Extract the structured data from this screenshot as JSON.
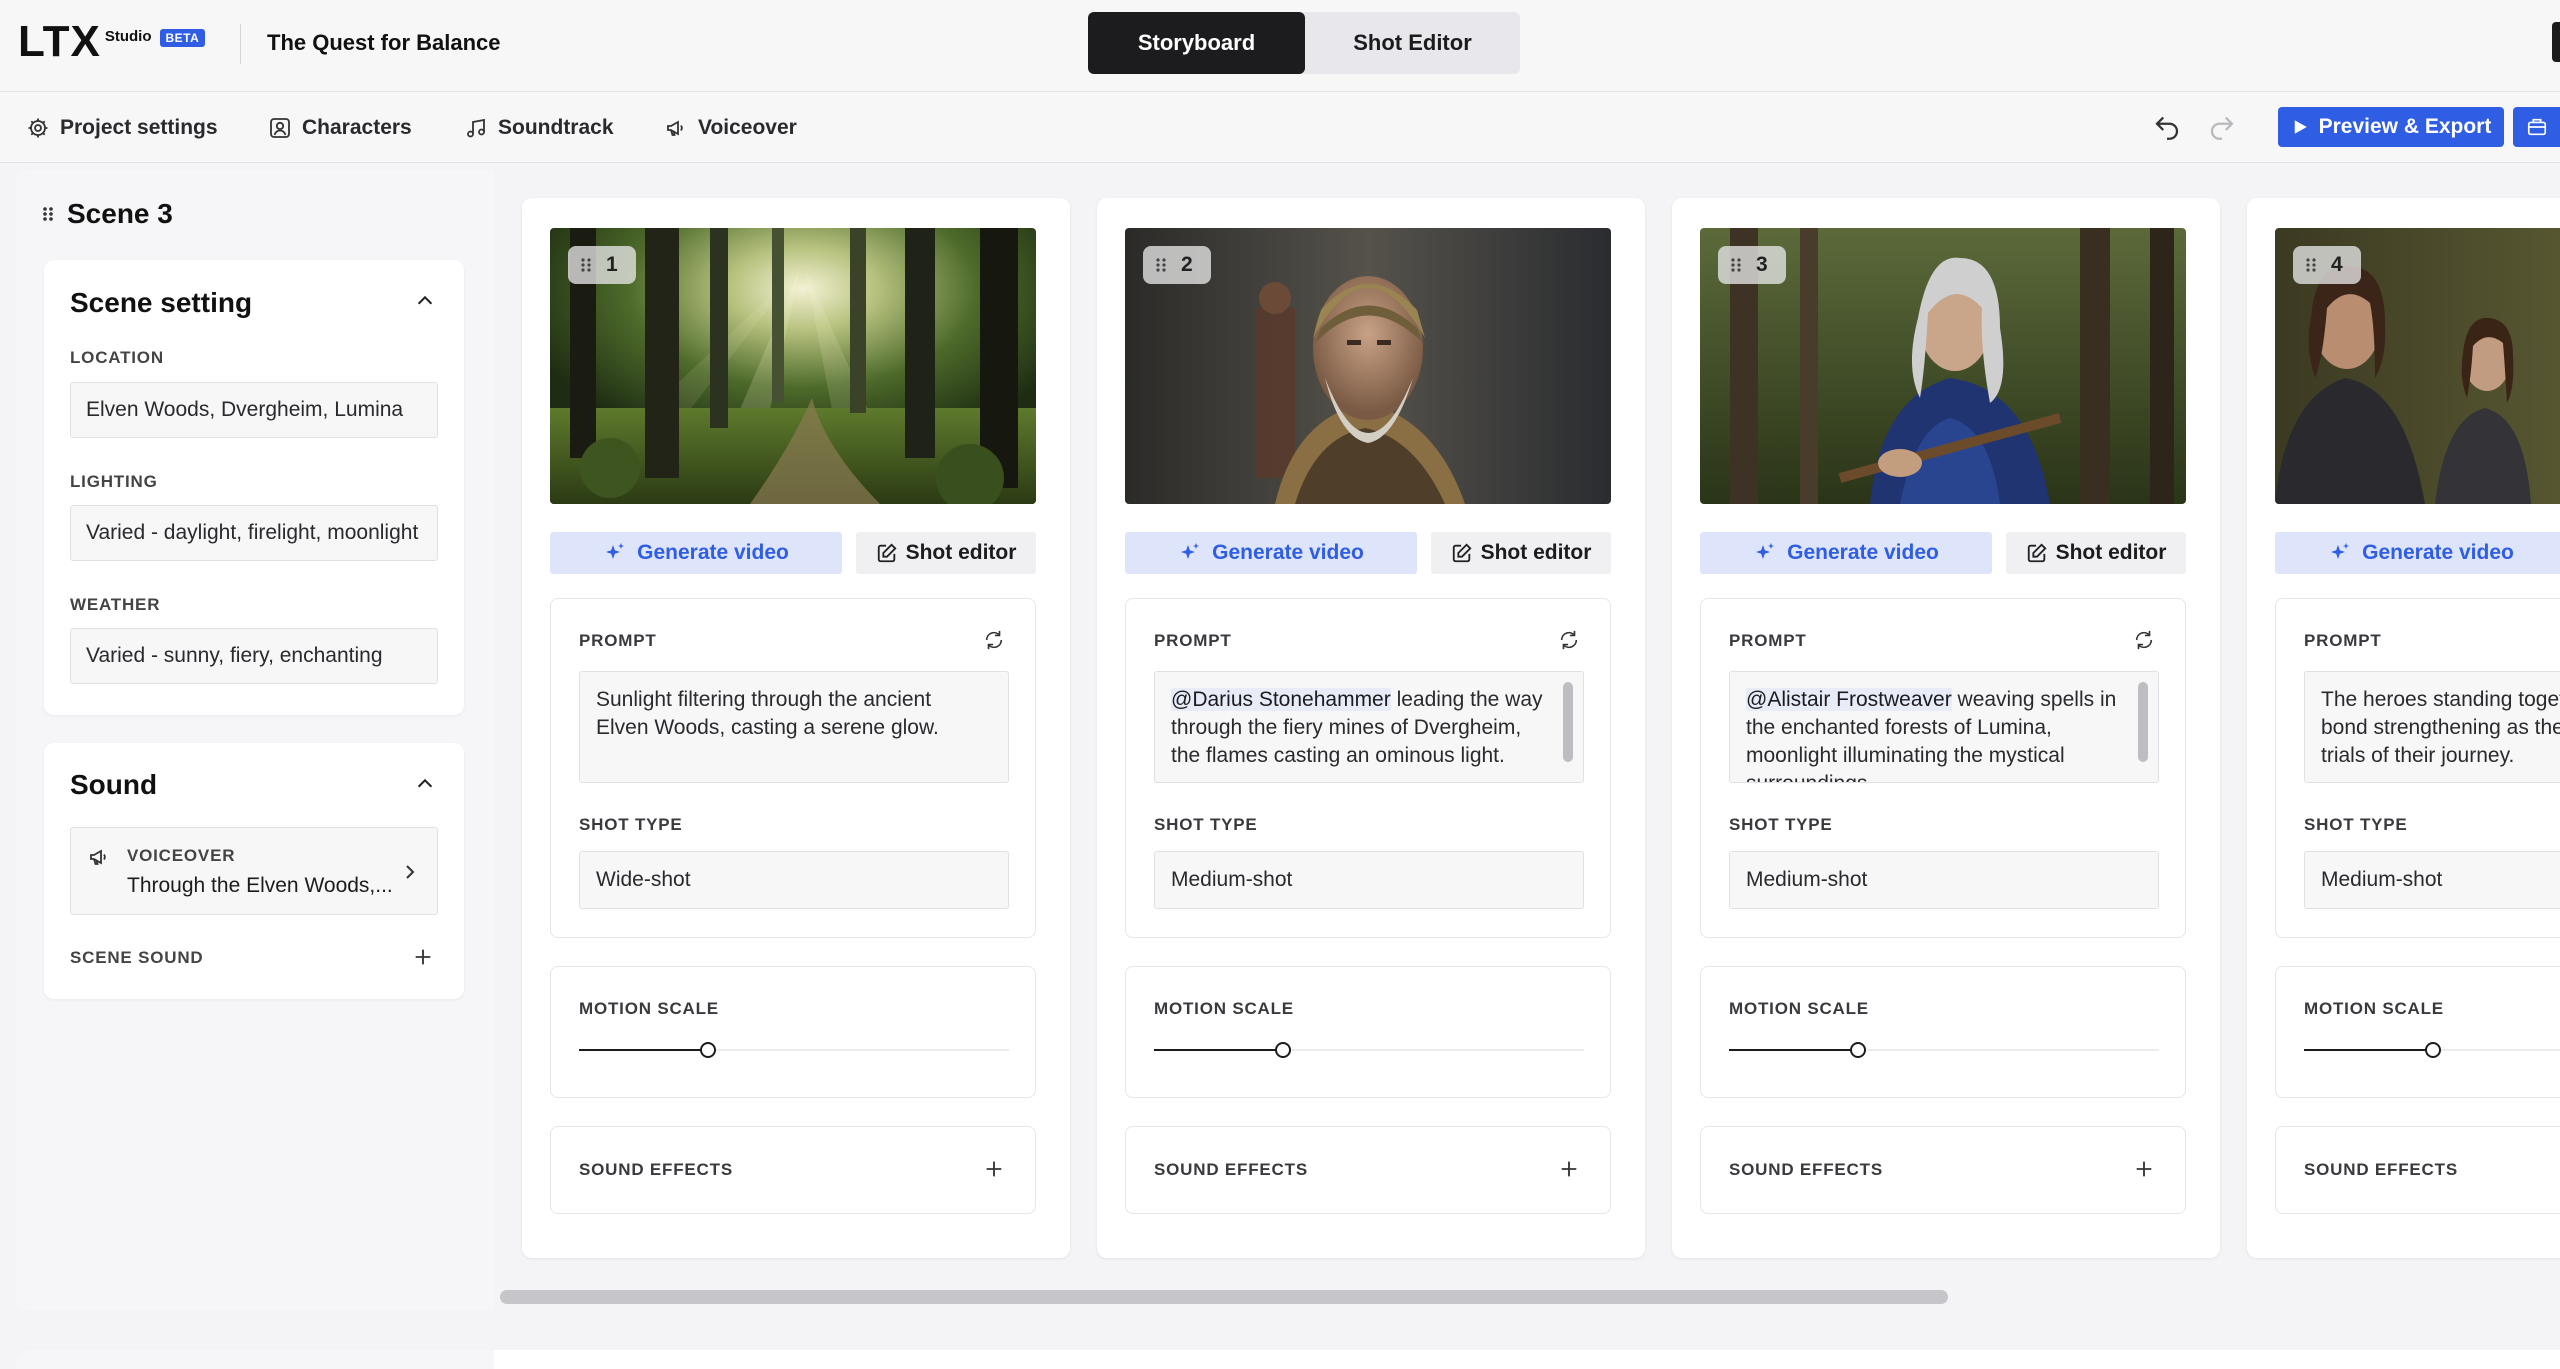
{
  "app": {
    "logo_text": "LTX",
    "logo_studio": "Studio",
    "logo_badge": "BETA",
    "project_title": "The Quest for Balance"
  },
  "view_tabs": [
    {
      "label": "Storyboard",
      "active": true
    },
    {
      "label": "Shot Editor",
      "active": false
    }
  ],
  "toolbar": {
    "items": [
      {
        "label": "Project settings",
        "icon": "gear-icon"
      },
      {
        "label": "Characters",
        "icon": "person-icon"
      },
      {
        "label": "Soundtrack",
        "icon": "music-note-icon"
      },
      {
        "label": "Voiceover",
        "icon": "megaphone-icon"
      }
    ],
    "export_label": "Preview & Export"
  },
  "scene": {
    "title": "Scene 3",
    "setting": {
      "heading": "Scene setting",
      "location_label": "LOCATION",
      "location_value": "Elven Woods, Dvergheim, Lumina",
      "lighting_label": "LIGHTING",
      "lighting_value": "Varied - daylight, firelight, moonlight",
      "weather_label": "WEATHER",
      "weather_value": "Varied - sunny, fiery, enchanting"
    },
    "sound": {
      "heading": "Sound",
      "voiceover_label": "VOICEOVER",
      "voiceover_text": "Through the Elven Woods,...",
      "scene_sound_label": "SCENE SOUND"
    }
  },
  "shot_labels": {
    "generate": "Generate video",
    "editor": "Shot editor",
    "prompt": "PROMPT",
    "shot_type": "SHOT TYPE",
    "motion_scale": "MOTION SCALE",
    "sound_effects": "SOUND EFFECTS"
  },
  "shots": [
    {
      "number": "1",
      "mention": "",
      "prompt": "Sunlight filtering through the ancient Elven Woods, casting a serene glow.",
      "shot_type": "Wide-shot",
      "motion_scale": 0.3
    },
    {
      "number": "2",
      "mention": "@Darius Stonehammer",
      "prompt": " leading the way through the fiery mines of Dvergheim, the flames casting an ominous light.",
      "shot_type": "Medium-shot",
      "motion_scale": 0.3
    },
    {
      "number": "3",
      "mention": "@Alistair Frostweaver",
      "prompt": " weaving spells in the enchanted forests of Lumina, moonlight illuminating the mystical surroundings.",
      "shot_type": "Medium-shot",
      "motion_scale": 0.3
    },
    {
      "number": "4",
      "mention": "",
      "prompt": "The heroes standing together, their bond strengthening as they face the trials of their journey.",
      "shot_type": "Medium-shot",
      "motion_scale": 0.3
    }
  ]
}
